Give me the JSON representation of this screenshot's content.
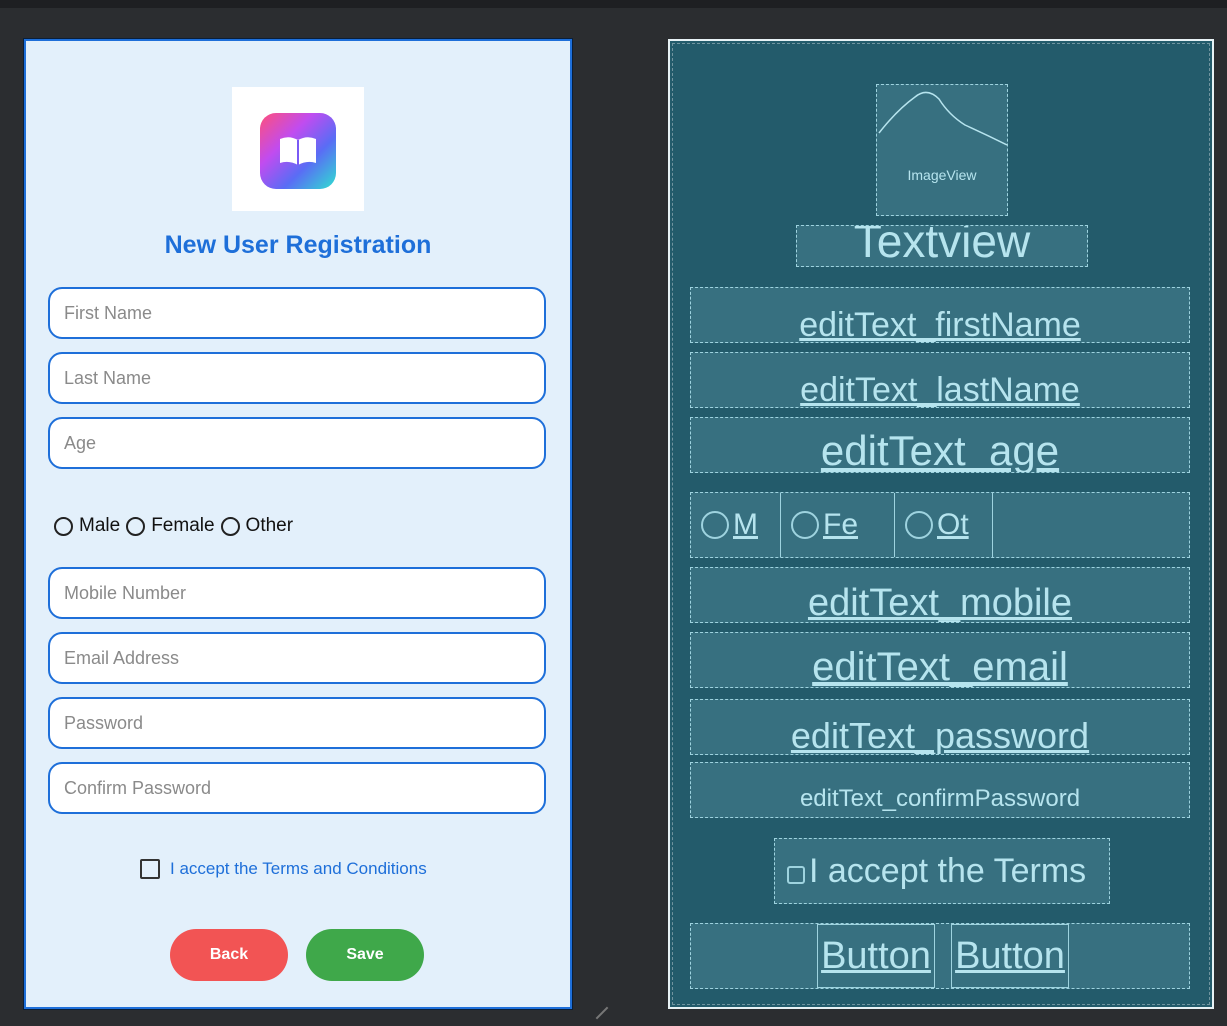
{
  "design": {
    "title": "New User Registration",
    "logo_icon": "book-icon",
    "fields": {
      "first_name": {
        "placeholder": "First Name",
        "value": ""
      },
      "last_name": {
        "placeholder": "Last Name",
        "value": ""
      },
      "age": {
        "placeholder": "Age",
        "value": ""
      },
      "mobile": {
        "placeholder": "Mobile Number",
        "value": ""
      },
      "email": {
        "placeholder": "Email Address",
        "value": ""
      },
      "password": {
        "placeholder": "Password",
        "value": ""
      },
      "confirm_password": {
        "placeholder": "Confirm Password",
        "value": ""
      }
    },
    "gender_options": [
      "Male",
      "Female",
      "Other"
    ],
    "terms_label": "I accept the Terms and Conditions",
    "terms_checked": false,
    "back_label": "Back",
    "save_label": "Save",
    "colors": {
      "accent": "#1e6fd9",
      "back": "#f25454",
      "save": "#3fa84a",
      "background": "#e3f0fb"
    }
  },
  "blueprint": {
    "image_label": "ImageView",
    "title_label": "Textview",
    "fields": {
      "first_name": "editText_firstName",
      "last_name": "editText_lastName",
      "age": "editText_age",
      "mobile": "editText_mobile",
      "email": "editText_email",
      "password": "editText_password",
      "confirm_password": "editText_confirmPassword"
    },
    "radio_labels": [
      "M",
      "Fe",
      "Ot"
    ],
    "terms_label": "I accept the Terms",
    "button_labels": [
      "Button",
      "Button"
    ],
    "colors": {
      "background": "#235b6b",
      "outline": "#9ed3df"
    }
  }
}
